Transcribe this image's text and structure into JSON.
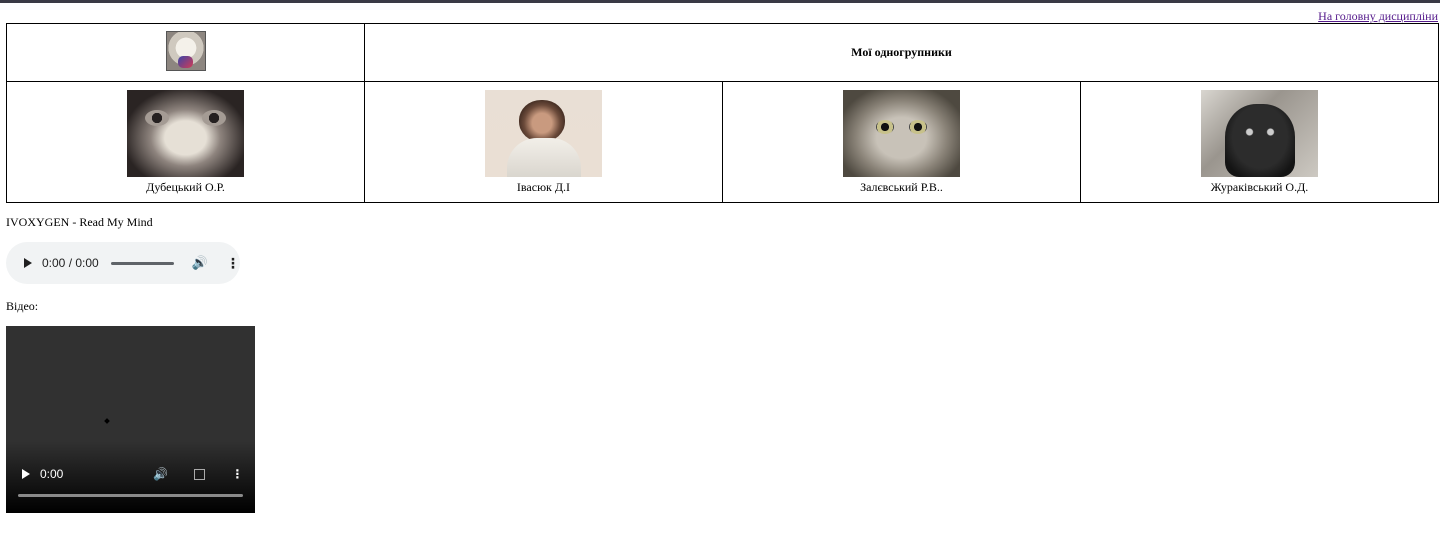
{
  "nav": {
    "home_link": "На головну дисципліни"
  },
  "header": {
    "title": "Мої одногрупники"
  },
  "people": [
    {
      "name": "Дубецький О.Р."
    },
    {
      "name": "Івасюк Д.І"
    },
    {
      "name": "Залєвський Р.В.."
    },
    {
      "name": "Жураківський О.Д."
    }
  ],
  "audio": {
    "song_title": "IVOXYGEN - Read My Mind",
    "time": "0:00 / 0:00",
    "icons": [
      "play-icon",
      "volume-icon",
      "more-options-icon"
    ]
  },
  "video": {
    "label": "Відео:",
    "time": "0:00",
    "icons": [
      "play-icon",
      "volume-icon",
      "fullscreen-icon",
      "more-options-icon"
    ]
  }
}
